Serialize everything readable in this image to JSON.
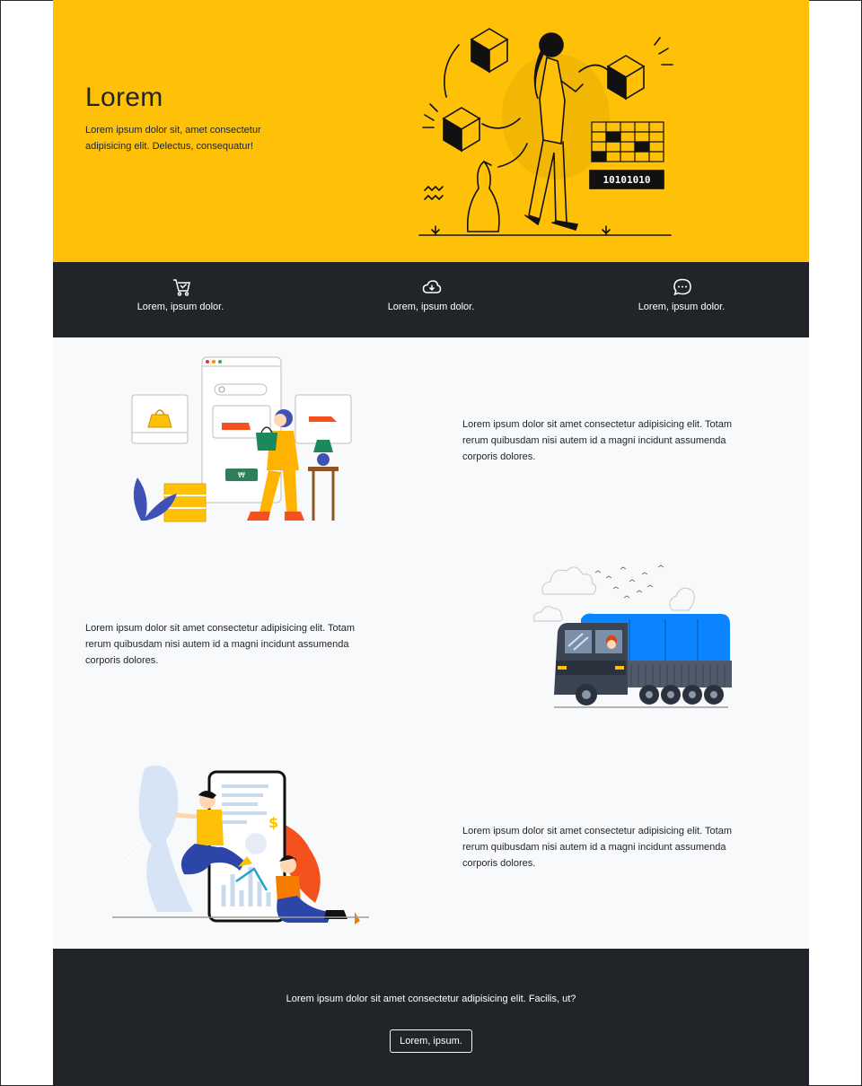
{
  "hero": {
    "title": "Lorem",
    "text": "Lorem ipsum dolor sit, amet consectetur adipisicing elit. Delectus, consequatur!",
    "binary_label": "10101010",
    "background": "#ffc107"
  },
  "features": [
    {
      "icon": "cart-check-icon",
      "label": "Lorem, ipsum dolor."
    },
    {
      "icon": "cloud-download-icon",
      "label": "Lorem, ipsum dolor."
    },
    {
      "icon": "chat-dots-icon",
      "label": "Lorem, ipsum dolor."
    }
  ],
  "sections": [
    {
      "text": "Lorem ipsum dolor sit amet consectetur adipisicing elit. Totam rerum quibusdam nisi autem id a magni incidunt assumenda corporis dolores.",
      "illustration": "online-shopping-illustration"
    },
    {
      "text": "Lorem ipsum dolor sit amet consectetur adipisicing elit. Totam rerum quibusdam nisi autem id a magni incidunt assumenda corporis dolores.",
      "illustration": "delivery-truck-illustration"
    },
    {
      "text": "Lorem ipsum dolor sit amet consectetur adipisicing elit. Totam rerum quibusdam nisi autem id a magni incidunt assumenda corporis dolores.",
      "illustration": "mobile-finance-illustration"
    }
  ],
  "footer": {
    "text": "Lorem ipsum dolor sit amet consectetur adipisicing elit. Facilis, ut?",
    "button_label": "Lorem, ipsum."
  },
  "colors": {
    "accent": "#ffc107",
    "dark": "#212529",
    "light": "#f8f9fa"
  }
}
